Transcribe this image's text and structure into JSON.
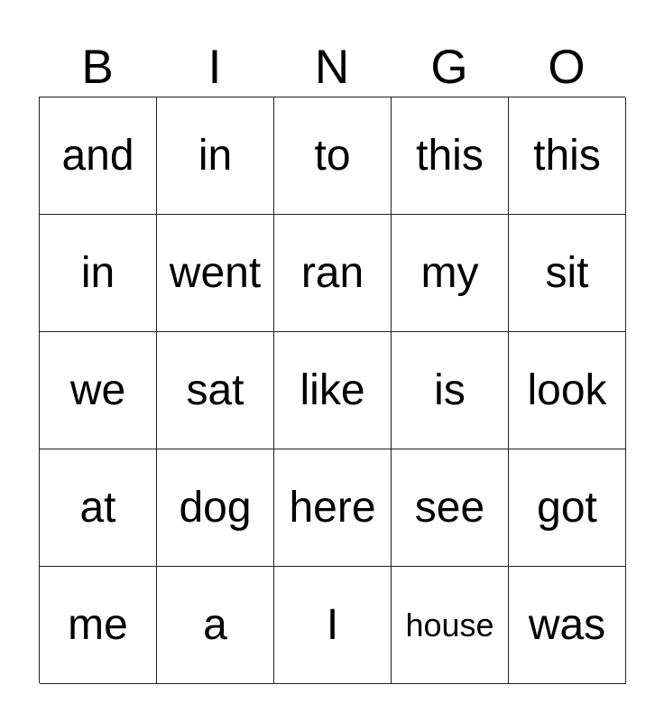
{
  "header": [
    "B",
    "I",
    "N",
    "G",
    "O"
  ],
  "cells": [
    [
      "and",
      "in",
      "to",
      "this",
      "this"
    ],
    [
      "in",
      "went",
      "ran",
      "my",
      "sit"
    ],
    [
      "we",
      "sat",
      "like",
      "is",
      "look"
    ],
    [
      "at",
      "dog",
      "here",
      "see",
      "got"
    ],
    [
      "me",
      "a",
      "I",
      "house",
      "was"
    ]
  ]
}
